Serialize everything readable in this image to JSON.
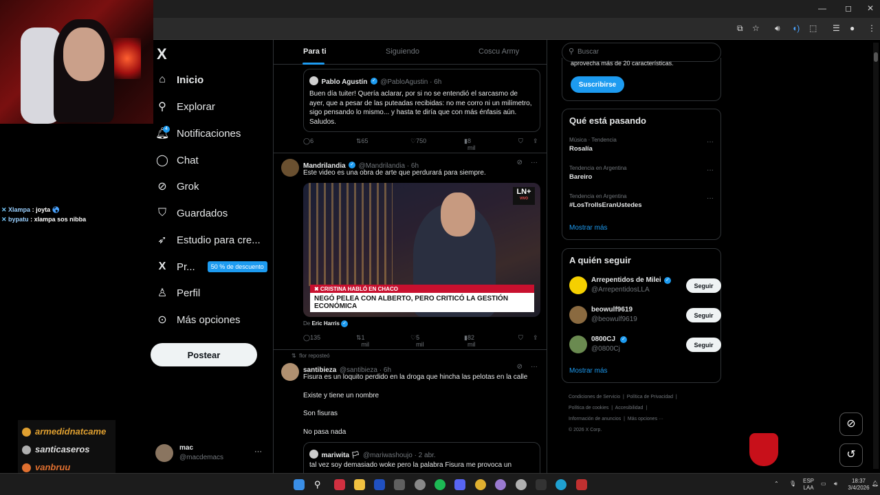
{
  "browser": {
    "window_controls": {
      "minimize": "—",
      "maximize": "◻",
      "close": "✕"
    }
  },
  "stream": {
    "chat": [
      {
        "user": "Xlampa",
        "message": ": joyta"
      },
      {
        "user": "bypatu",
        "message": ": xlampa sos nibba"
      }
    ],
    "alerts": [
      {
        "name": "armedidnatcame",
        "color": "#e0a030"
      },
      {
        "name": "santicaseros",
        "color": "#b0b0b0"
      },
      {
        "name": "vanbruu",
        "color": "#e07030"
      }
    ]
  },
  "sidebar": {
    "logo": "X",
    "items": [
      {
        "label": "Inicio",
        "icon": "home-icon",
        "glyph": "⌂"
      },
      {
        "label": "Explorar",
        "icon": "search-icon",
        "glyph": "⚲"
      },
      {
        "label": "Notificaciones",
        "icon": "bell-icon",
        "glyph": "🔔︎",
        "badge": "4"
      },
      {
        "label": "Chat",
        "icon": "chat-icon",
        "glyph": "◯"
      },
      {
        "label": "Grok",
        "icon": "grok-icon",
        "glyph": "⊘"
      },
      {
        "label": "Guardados",
        "icon": "bookmark-icon",
        "glyph": "⛉"
      },
      {
        "label": "Estudio para cre...",
        "icon": "rocket-icon",
        "glyph": "➶"
      },
      {
        "label": "Pr...",
        "icon": "x-premium-icon",
        "glyph": "X",
        "promo": "50 % de descuento"
      },
      {
        "label": "Perfil",
        "icon": "person-icon",
        "glyph": "♙"
      },
      {
        "label": "Más opciones",
        "icon": "more-circle-icon",
        "glyph": "⊙"
      }
    ],
    "post_button": "Postear",
    "account": {
      "name": "mac",
      "handle": "@macdemacs",
      "more": "···"
    }
  },
  "feed": {
    "tabs": [
      "Para ti",
      "Siguiendo",
      "Coscu Army"
    ],
    "tweets": [
      {
        "quote": {
          "name": "Pablo Agustín",
          "handle": "@PabloAgustin · 6h",
          "body": "Buen día tuiter! Quería aclarar, por si no se entendió el sarcasmo de ayer, que a pesar de las puteadas recibidas: no me corro ni un milímetro, sigo pensando lo mismo... y hasta te diría que con más énfasis aún. Saludos."
        },
        "stats": {
          "replies": "6",
          "reposts": "65",
          "likes": "750",
          "views": "8 mil"
        }
      },
      {
        "name": "Mandrilandia",
        "handle": "@Mandrilandia · 6h",
        "body": "Este video es una obra de arte que perdurará para siempre.",
        "media": {
          "channel": "LN+",
          "channel_sub": "VIVO",
          "lower_third_1": "✖ CRISTINA HABLÓ EN CHACO",
          "lower_third_2": "NEGÓ PELEA CON ALBERTO, PERO CRITICÓ LA GESTIÓN ECONÓMICA"
        },
        "from_label": "De",
        "from_name": "Eric Harris",
        "stats": {
          "replies": "135",
          "reposts": "1 mil",
          "likes": "5 mil",
          "views": "82 mil"
        }
      },
      {
        "reposted_by": "flor reposteó",
        "name": "santibieza",
        "handle": "@santibieza · 6h",
        "lines": [
          "Fisura es un loquito perdido en la droga que hincha las pelotas en la calle",
          "Existe y tiene un nombre",
          "Son fisuras",
          "No pasa nada"
        ],
        "quote": {
          "name": "mariwita 🏳",
          "handle": "@mariwashoujo · 2 abr.",
          "body": "tal vez soy demasiado woke pero la palabra Fisura me provoca un"
        }
      }
    ]
  },
  "right": {
    "search_placeholder": "Buscar",
    "premium": {
      "text": "aprovecha más de 20 características.",
      "button": "Suscribirse"
    },
    "trends": {
      "title": "Qué está pasando",
      "items": [
        {
          "meta": "Música · Tendencia",
          "name": "Rosalía"
        },
        {
          "meta": "Tendencia en Argentina",
          "name": "Bareiro"
        },
        {
          "meta": "Tendencia en Argentina",
          "name": "#LosTrollsEranUstedes"
        }
      ],
      "show_more": "Mostrar más"
    },
    "who_to_follow": {
      "title": "A quién seguir",
      "items": [
        {
          "name": "Arrepentidos de Milei",
          "handle": "@ArrepentidosLLA",
          "button": "Seguir",
          "color": "#f5d000"
        },
        {
          "name": "beowulf9619",
          "handle": "@beowulf9619",
          "button": "Seguir",
          "color": "#8a6a40"
        },
        {
          "name": "0800CJ",
          "handle": "@0800Cj",
          "button": "Seguir",
          "color": "#6a8a50"
        }
      ],
      "show_more": "Mostrar más"
    },
    "footer": {
      "links": [
        "Condiciones de Servicio",
        "Política de Privacidad",
        "Política de cookies",
        "Accesibilidad",
        "Información de anuncios",
        "Más opciones ···"
      ],
      "copyright": "© 2026 X Corp."
    }
  },
  "taskbar": {
    "lang": "ESP",
    "lang2": "LAA",
    "time": "18:37",
    "date": "3/4/2026"
  }
}
